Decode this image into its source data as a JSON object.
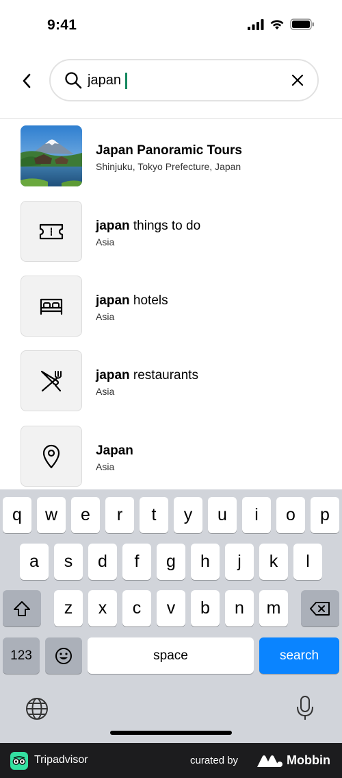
{
  "status_bar": {
    "time": "9:41"
  },
  "search": {
    "query": "japan",
    "placeholder": ""
  },
  "results": [
    {
      "title_bold": "Japan Panoramic Tours",
      "title_rest": "",
      "subtitle": "Shinjuku, Tokyo Prefecture, Japan",
      "icon": "photo"
    },
    {
      "title_bold": "japan",
      "title_rest": " things to do",
      "subtitle": "Asia",
      "icon": "ticket-icon"
    },
    {
      "title_bold": "japan",
      "title_rest": " hotels",
      "subtitle": "Asia",
      "icon": "bed-icon"
    },
    {
      "title_bold": "japan",
      "title_rest": " restaurants",
      "subtitle": "Asia",
      "icon": "fork-knife-icon"
    },
    {
      "title_bold": "Japan",
      "title_rest": "",
      "subtitle": "Asia",
      "icon": "map-pin-icon"
    }
  ],
  "keyboard": {
    "row1": [
      "q",
      "w",
      "e",
      "r",
      "t",
      "y",
      "u",
      "i",
      "o",
      "p"
    ],
    "row2": [
      "a",
      "s",
      "d",
      "f",
      "g",
      "h",
      "j",
      "k",
      "l"
    ],
    "row3": [
      "z",
      "x",
      "c",
      "v",
      "b",
      "n",
      "m"
    ],
    "numbers_label": "123",
    "space_label": "space",
    "search_label": "search"
  },
  "footer": {
    "brand": "Tripadvisor",
    "curated_by": "curated by",
    "curator": "Mobbin"
  },
  "colors": {
    "accent_green": "#34e0a1",
    "caret": "#15885f",
    "keyboard_blue": "#0a84ff"
  }
}
